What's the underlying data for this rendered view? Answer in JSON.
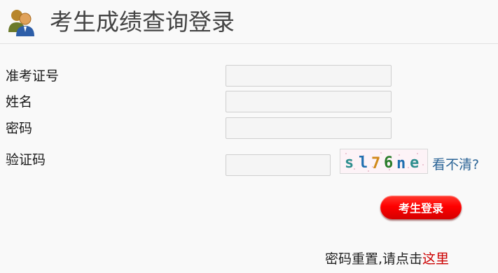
{
  "header": {
    "title": "考生成绩查询登录",
    "icon": "users-icon"
  },
  "form": {
    "exam_id_label": "准考证号",
    "exam_id_value": "",
    "name_label": "姓名",
    "name_value": "",
    "password_label": "密码",
    "password_value": "",
    "captcha_label": "验证码",
    "captcha_value": "",
    "captcha_text": "sl76ne",
    "refresh_label": "看不清?",
    "login_label": "考生登录"
  },
  "footer": {
    "reset_prefix": "密码重置,请点击",
    "reset_link": "这里"
  },
  "colors": {
    "link": "#2a6496",
    "reset_link": "#cc0000",
    "login_button": "#ff0000"
  }
}
